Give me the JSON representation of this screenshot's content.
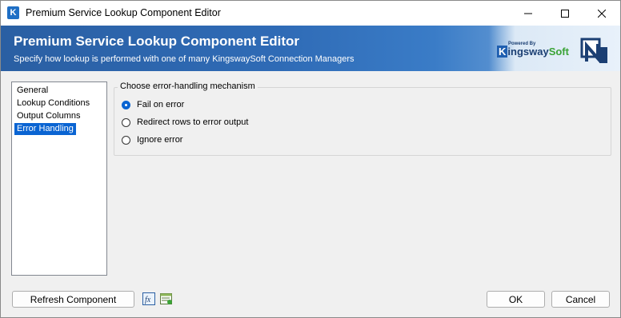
{
  "window": {
    "title": "Premium Service Lookup Component Editor",
    "app_icon_letter": "K",
    "controls": [
      "minimize-icon",
      "maximize-icon",
      "close-icon"
    ]
  },
  "banner": {
    "title": "Premium Service Lookup Component Editor",
    "subtitle": "Specify how lookup is performed with one of many KingswaySoft Connection Managers",
    "brand": {
      "powered_by": "Powered By",
      "name_k": "K",
      "name_ingsway": "ingsway",
      "name_soft": "Soft"
    }
  },
  "nav": {
    "items": [
      {
        "label": "General",
        "selected": false
      },
      {
        "label": "Lookup Conditions",
        "selected": false
      },
      {
        "label": "Output Columns",
        "selected": false
      },
      {
        "label": "Error Handling",
        "selected": true
      }
    ]
  },
  "error_handling": {
    "group_label": "Choose error-handling mechanism",
    "options": [
      {
        "label": "Fail on error",
        "checked": true
      },
      {
        "label": "Redirect rows to error output",
        "checked": false
      },
      {
        "label": "Ignore error",
        "checked": false
      }
    ]
  },
  "footer": {
    "refresh_label": "Refresh Component",
    "fx_icon": "fx-expression-icon",
    "variables_icon": "variables-icon",
    "ok_label": "OK",
    "cancel_label": "Cancel"
  },
  "colors": {
    "selection": "#0a64d2",
    "banner_start": "#2a5fa3",
    "banner_end": "#8fb8e2",
    "brand_green": "#3aa336"
  }
}
